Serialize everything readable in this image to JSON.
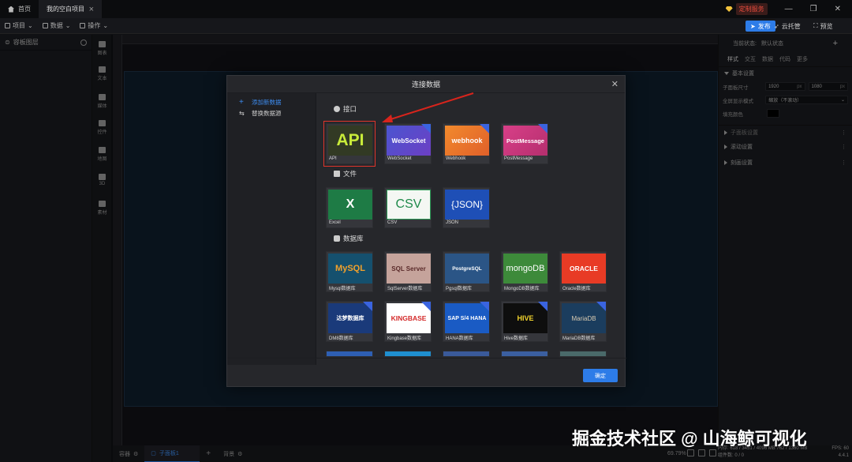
{
  "titlebar": {
    "tabs": [
      {
        "label": "首页"
      },
      {
        "label": "我的空白项目"
      }
    ],
    "vip_label": "定制服务"
  },
  "toolbar": {
    "menus": [
      {
        "label": "项目"
      },
      {
        "label": "数据"
      },
      {
        "label": "操作"
      }
    ],
    "publish_label": "发布",
    "cloud_label": "云托管",
    "preview_label": "预览"
  },
  "layers": {
    "title": "容板图层"
  },
  "rail": [
    {
      "label": "图表"
    },
    {
      "label": "文本"
    },
    {
      "label": "媒体"
    },
    {
      "label": "控件"
    },
    {
      "label": "地图"
    },
    {
      "label": "3D"
    },
    {
      "label": "素材"
    }
  ],
  "bottombar": {
    "items": [
      "容器",
      "子面板1",
      "背景"
    ],
    "zoom": "69.79%",
    "memory": "内存: 618 / 3451 / 4096 MB  762 / 1360 MB",
    "components": "组件数: 0 / 0",
    "fps": "FPS: 60",
    "version": "4.4.1"
  },
  "props": {
    "state_label": "当前状态:",
    "state_value": "默认状态",
    "tabs": [
      "样式",
      "交互",
      "数据",
      "代码",
      "更多"
    ],
    "section_basic": "基本设置",
    "size_label": "子面板尺寸",
    "width": "1920",
    "height": "1080",
    "px": "px",
    "fullscreen_label": "全屏显示模式",
    "fullscreen_value": "缩放（不滚动）",
    "fill_label": "填充颜色",
    "sections": [
      "子面板设置",
      "滚动设置",
      "刻画设置"
    ]
  },
  "modal": {
    "title": "连接数据",
    "ok_label": "确定",
    "sidebar": [
      {
        "label": "添加新数据"
      },
      {
        "label": "替换数据源"
      }
    ],
    "categories": [
      {
        "title": "接口",
        "items": [
          {
            "label": "API",
            "thumb": "API"
          },
          {
            "label": "WebSocket",
            "thumb": "WebSocket"
          },
          {
            "label": "Webhook",
            "thumb": "webhook"
          },
          {
            "label": "PostMessage",
            "thumb": "PostMessage"
          }
        ]
      },
      {
        "title": "文件",
        "items": [
          {
            "label": "Excel",
            "thumb": "X"
          },
          {
            "label": "CSV",
            "thumb": "CSV"
          },
          {
            "label": "JSON",
            "thumb": "{JSON}"
          }
        ]
      },
      {
        "title": "数据库",
        "items": [
          {
            "label": "Mysql数据库",
            "thumb": "MySQL"
          },
          {
            "label": "SqlServer数据库",
            "thumb": "SQL Server"
          },
          {
            "label": "Pgsql数据库",
            "thumb": "PostgreSQL"
          },
          {
            "label": "MongoDB数据库",
            "thumb": "mongoDB"
          },
          {
            "label": "Oracle数据库",
            "thumb": "ORACLE"
          },
          {
            "label": "DM8数据库",
            "thumb": "达梦数据库"
          },
          {
            "label": "Kingbase数据库",
            "thumb": "KINGBASE"
          },
          {
            "label": "HANA数据库",
            "thumb": "SAP S/4 HANA"
          },
          {
            "label": "Hive数据库",
            "thumb": "HIVE"
          },
          {
            "label": "MariaDB数据库",
            "thumb": "MariaDB"
          }
        ]
      }
    ]
  },
  "watermark": "掘金技术社区 @ 山海鲸可视化",
  "colors": {
    "accent": "#2d7ce8",
    "highlight": "#e0352b",
    "arrow": "#d8241c"
  }
}
